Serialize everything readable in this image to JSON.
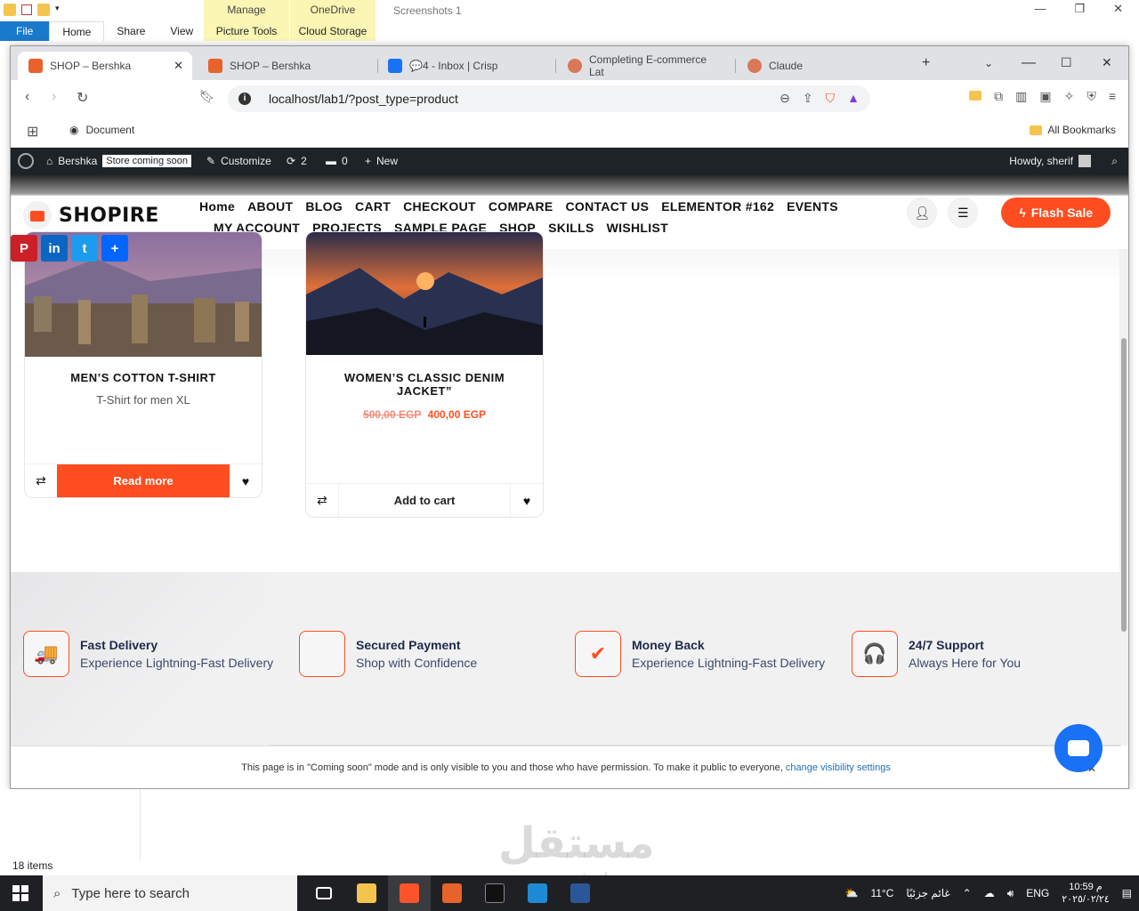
{
  "explorer": {
    "title": "Screenshots 1",
    "tabs": [
      "File",
      "Home",
      "Share",
      "View"
    ],
    "context_tabs": [
      {
        "group": "Manage",
        "tab": "Picture Tools"
      },
      {
        "group": "OneDrive",
        "tab": "Cloud Storage"
      }
    ],
    "items_count": "18 items"
  },
  "browser": {
    "tabs": [
      {
        "label": "SHOP – Bershka",
        "color": "#e8622c",
        "active": true
      },
      {
        "label": "SHOP – Bershka",
        "color": "#e8622c"
      },
      {
        "label": "💬4 - Inbox | Crisp",
        "color": "#1972f5"
      },
      {
        "label": "Completing E-commerce Lat",
        "color": "#d97757"
      },
      {
        "label": "Claude",
        "color": "#d97757"
      }
    ],
    "url": "localhost/lab1/?post_type=product",
    "bookmark_doc": "Document",
    "all_bookmarks": "All Bookmarks"
  },
  "adminbar": {
    "site": "Bershka",
    "badge": "Store coming soon",
    "customize": "Customize",
    "updates": "2",
    "comments": "0",
    "new": "New",
    "howdy": "Howdy, sherif"
  },
  "site": {
    "logo": "SHOPIRE",
    "menu_row1": [
      "Home",
      "ABOUT",
      "BLOG",
      "CART",
      "CHECKOUT",
      "COMPARE",
      "CONTACT US",
      "ELEMENTOR #162",
      "EVENTS"
    ],
    "menu_row2": [
      "MY ACCOUNT",
      "PROJECTS",
      "SAMPLE PAGE",
      "SHOP",
      "SKILLS",
      "WISHLIST"
    ],
    "flash_sale": "Flash Sale",
    "share": [
      {
        "name": "pinterest",
        "glyph": "P",
        "color": "#cb2027"
      },
      {
        "name": "linkedin",
        "glyph": "in",
        "color": "#0a66c2"
      },
      {
        "name": "twitter",
        "glyph": "t",
        "color": "#1d9bf0"
      },
      {
        "name": "share",
        "glyph": "+",
        "color": "#0166ff"
      }
    ]
  },
  "products": [
    {
      "title": "MEN’S COTTON T-SHIRT",
      "subtitle": "T-Shirt for men XL",
      "action": "Read more"
    },
    {
      "title": "WOMEN’S CLASSIC DENIM JACKET”",
      "old_price": "500,00 EGP",
      "price": "400,00 EGP",
      "action": "Add to cart"
    }
  ],
  "features": [
    {
      "title": "Fast Delivery",
      "sub": "Experience Lightning-Fast Delivery",
      "icon": "truck-icon",
      "glyph": "🚚"
    },
    {
      "title": "Secured Payment",
      "sub": "Shop with Confidence",
      "icon": "lock-icon",
      "glyph": ""
    },
    {
      "title": "Money Back",
      "sub": "Experience Lightning-Fast Delivery",
      "icon": "check-icon",
      "glyph": "✔"
    },
    {
      "title": "24/7 Support",
      "sub": "Always Here for You",
      "icon": "headphones-icon",
      "glyph": "🎧"
    }
  ],
  "coming_soon": {
    "text": "This page is in \"Coming soon\" mode and is only visible to you and those who have permission. To make it public to everyone, ",
    "link": "change visibility settings"
  },
  "taskbar": {
    "search": "Type here to search",
    "weather_temp": "11°C",
    "weather_desc": "غائم جزئيًا",
    "lang": "ENG",
    "time": "10:59 م",
    "date": "٢٠٢٥/٠٢/٢٤"
  },
  "watermark": {
    "main": "مستقل",
    "sub": "mostaql.com"
  }
}
